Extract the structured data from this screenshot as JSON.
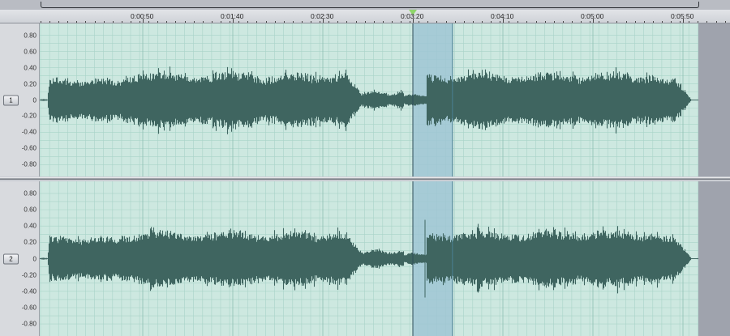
{
  "timeline": {
    "ticks": [
      "0:00:50",
      "0:01:40",
      "0:02:30",
      "0:03:20",
      "0:04:10",
      "0:05:00",
      "0:05:50"
    ],
    "playhead": "0:03:20"
  },
  "channels": [
    {
      "label": "1",
      "amplitude_labels": [
        "0.80",
        "0.60",
        "0.40",
        "0.20",
        "0",
        "-0.20",
        "-0.40",
        "-0.60",
        "-0.80"
      ]
    },
    {
      "label": "2",
      "amplitude_labels": [
        "0.80",
        "0.60",
        "0.40",
        "0.20",
        "0",
        "-0.20",
        "-0.40",
        "-0.60",
        "-0.80"
      ]
    }
  ],
  "selection": {
    "start": "0:03:20",
    "end": "0:03:42"
  },
  "colors": {
    "waveform": "#3f6560",
    "background": "#cde8e0",
    "grid": "#a9d3c8",
    "selection": "#9fc5d4",
    "beyond_end": "#9fa3ad",
    "playhead": "#8fd66a"
  }
}
